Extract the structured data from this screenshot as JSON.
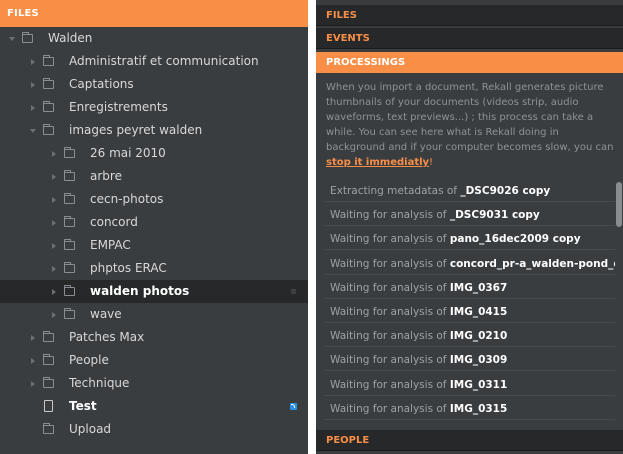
{
  "left_panel": {
    "header": "FILES",
    "tree": [
      {
        "label": "Walden",
        "level": 0,
        "expanded": true,
        "icon": "folder-icon"
      },
      {
        "label": "Administratif et communication",
        "level": 1,
        "icon": "folder-icon"
      },
      {
        "label": "Captations",
        "level": 1,
        "icon": "folder-icon"
      },
      {
        "label": "Enregistrements",
        "level": 1,
        "icon": "folder-icon"
      },
      {
        "label": "images peyret walden",
        "level": 1,
        "expanded": true,
        "icon": "folder-icon"
      },
      {
        "label": "26 mai 2010",
        "level": 2,
        "icon": "folder-icon"
      },
      {
        "label": "arbre",
        "level": 2,
        "icon": "folder-icon"
      },
      {
        "label": "cecn-photos",
        "level": 2,
        "icon": "folder-icon"
      },
      {
        "label": "concord",
        "level": 2,
        "icon": "folder-icon"
      },
      {
        "label": "EMPAC",
        "level": 2,
        "icon": "folder-icon"
      },
      {
        "label": "phptos ERAC",
        "level": 2,
        "icon": "folder-icon"
      },
      {
        "label": "walden photos",
        "level": 2,
        "icon": "folder-icon",
        "selected": true
      },
      {
        "label": "wave",
        "level": 2,
        "icon": "folder-icon"
      },
      {
        "label": "Patches Max",
        "level": 1,
        "icon": "folder-icon"
      },
      {
        "label": "People",
        "level": 1,
        "icon": "folder-icon"
      },
      {
        "label": "Technique",
        "level": 1,
        "icon": "folder-icon"
      },
      {
        "label": "Test",
        "level": 1,
        "icon": "file-icon",
        "bold": true,
        "rss": true
      },
      {
        "label": "Upload",
        "level": 1,
        "icon": "folder-icon",
        "no_arrow": true
      }
    ]
  },
  "right_panel": {
    "sections": {
      "files": "FILES",
      "events": "EVENTS",
      "processings": "PROCESSINGS",
      "people": "PEOPLE"
    },
    "description": "When you import a document, Rekall generates picture thumbnails of your documents (videos strip, audio waveforms, text previews...) ; this process can take a while. You can see here what is Rekall doing in background and if your computer becomes slow, you can",
    "stop_link": "stop it immediatly",
    "stop_suffix": "!",
    "processes": [
      {
        "action": "Extracting metadatas of ",
        "file": "_DSC9026 copy"
      },
      {
        "action": "Waiting for analysis of ",
        "file": "_DSC9031 copy"
      },
      {
        "action": "Waiting for analysis of ",
        "file": "pano_16dec2009 copy"
      },
      {
        "action": "Waiting for analysis of ",
        "file": "concord_pr-a_walden-pond_concord"
      },
      {
        "action": "Waiting for analysis of ",
        "file": "IMG_0367"
      },
      {
        "action": "Waiting for analysis of ",
        "file": "IMG_0415"
      },
      {
        "action": "Waiting for analysis of ",
        "file": "IMG_0210"
      },
      {
        "action": "Waiting for analysis of ",
        "file": "IMG_0309"
      },
      {
        "action": "Waiting for analysis of ",
        "file": "IMG_0311"
      },
      {
        "action": "Waiting for analysis of ",
        "file": "IMG_0315"
      }
    ]
  },
  "colors": {
    "accent": "#f98e47",
    "panel": "#3a3d40",
    "section_bar": "#262829",
    "selected_row": "#262829",
    "rss": "#2d8fe0"
  }
}
